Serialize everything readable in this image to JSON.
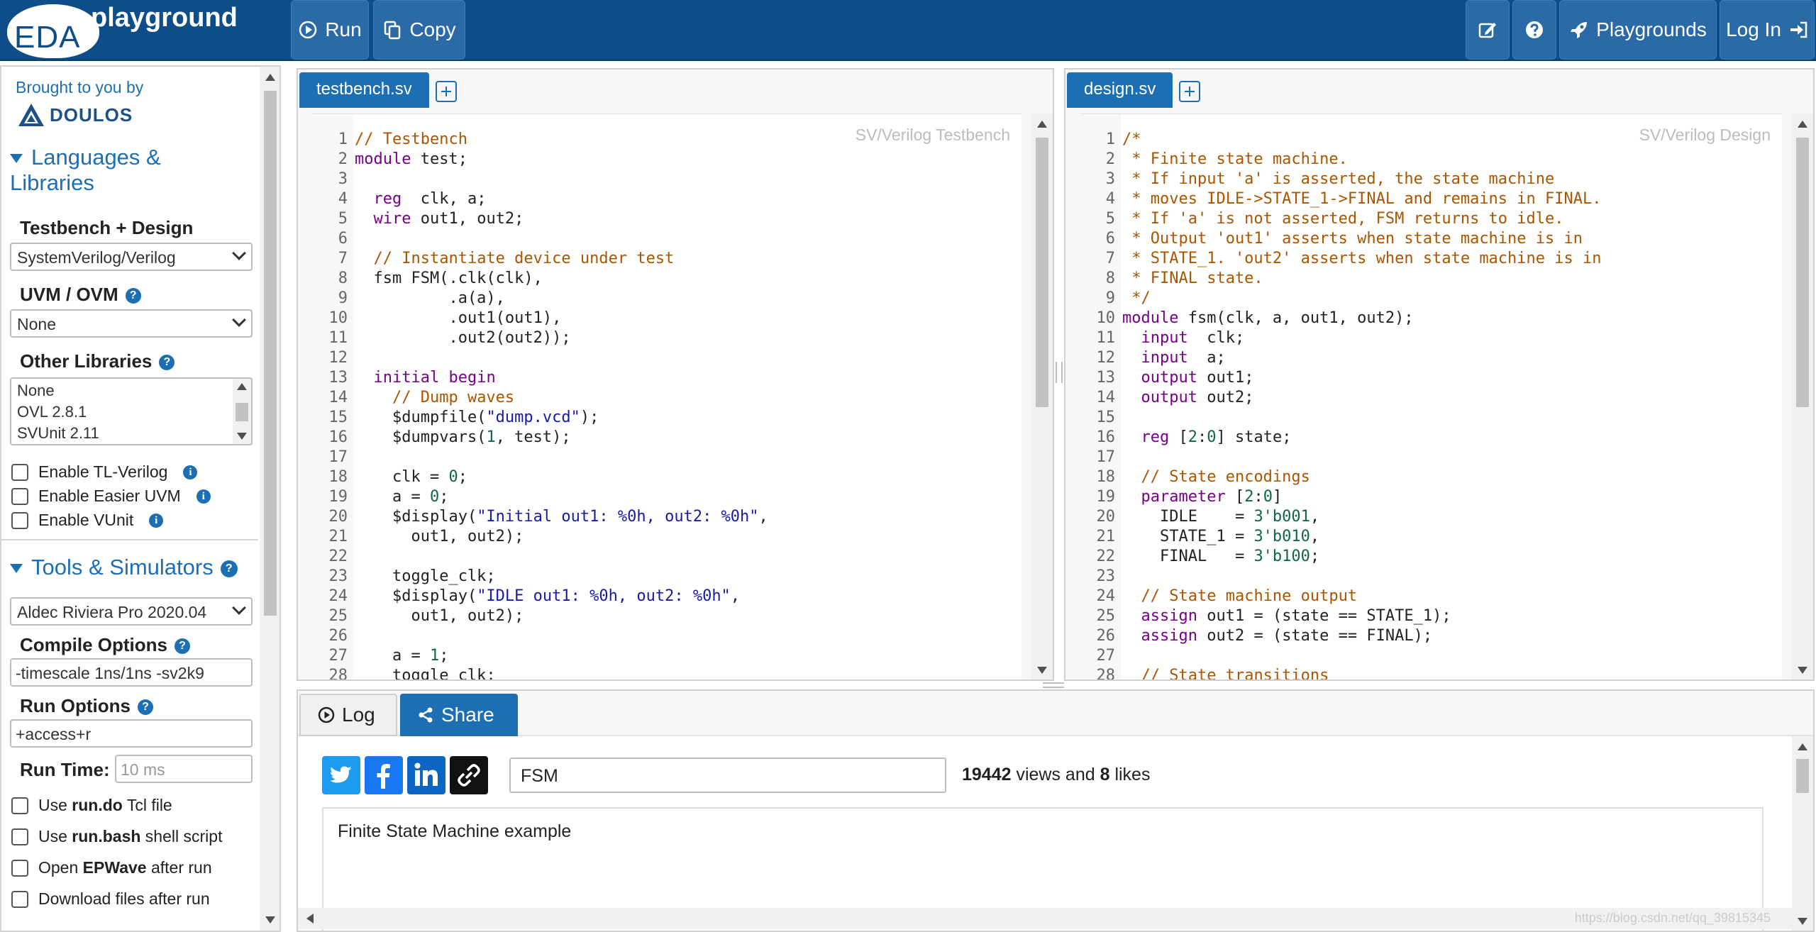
{
  "navbar": {
    "logo_eda": "EDA",
    "logo_play": "playground",
    "run_label": "Run",
    "copy_label": "Copy",
    "playgrounds_label": "Playgrounds",
    "login_label": "Log In"
  },
  "sidebar": {
    "brought_by": "Brought to you by",
    "doulos": "DOULOS",
    "languages_section": "Languages & Libraries",
    "testbench_design_label": "Testbench + Design",
    "testbench_design_value": "SystemVerilog/Verilog",
    "uvm_label": "UVM / OVM",
    "uvm_value": "None",
    "other_libraries_label": "Other Libraries",
    "other_libraries_options": [
      "None",
      "OVL 2.8.1",
      "SVUnit 2.11"
    ],
    "checkbox_tl_verilog": "Enable TL-Verilog",
    "checkbox_easier_uvm": "Enable Easier UVM",
    "checkbox_vunit": "Enable VUnit",
    "tools_section": "Tools & Simulators",
    "simulator_value": "Aldec Riviera Pro 2020.04",
    "compile_options_label": "Compile Options",
    "compile_options_value": "-timescale 1ns/1ns -sv2k9",
    "run_options_label": "Run Options",
    "run_options_value": "+access+r",
    "run_time_label": "Run Time:",
    "run_time_placeholder": "10 ms",
    "checkbox_rundo": {
      "pre": "Use ",
      "bold": "run.do",
      "post": " Tcl file"
    },
    "checkbox_runbash": {
      "pre": "Use ",
      "bold": "run.bash",
      "post": " shell script"
    },
    "checkbox_epwave": {
      "pre": "Open ",
      "bold": "EPWave",
      "post": " after run"
    },
    "checkbox_download": "Download files after run"
  },
  "editor_left": {
    "tab_label": "testbench.sv",
    "placeholder": "SV/Verilog Testbench"
  },
  "editor_right": {
    "tab_label": "design.sv",
    "placeholder": "SV/Verilog Design"
  },
  "bottom": {
    "log_tab": "Log",
    "share_tab": "Share",
    "title_value": "FSM",
    "views": "19442",
    "views_text": " views and ",
    "likes": "8",
    "likes_text": " likes",
    "description": "Finite State Machine example",
    "watermark": "https://blog.csdn.net/qq_39815345"
  },
  "colors": {
    "navbar_bg": "#0d4e8a",
    "accent": "#1d6fb4",
    "comment": "#aa5500",
    "keyword": "#770088",
    "string": "#1a1aa6",
    "number": "#116644"
  }
}
